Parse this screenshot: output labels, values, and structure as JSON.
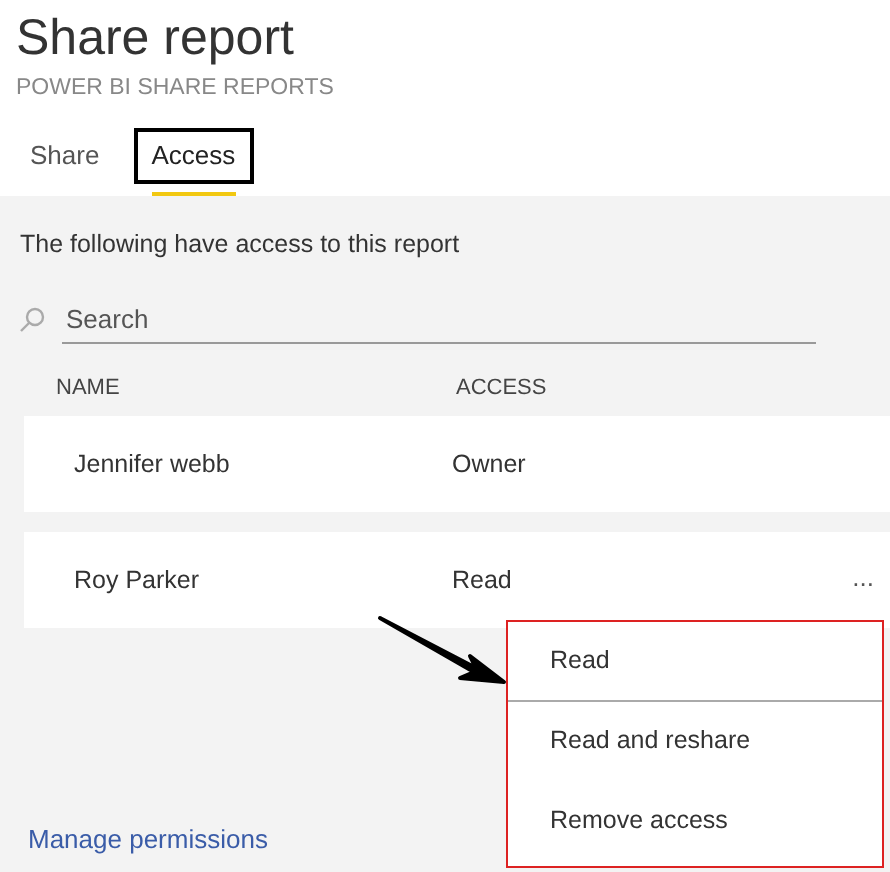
{
  "title": "Share report",
  "subtitle": "POWER BI SHARE REPORTS",
  "tabs": [
    {
      "label": "Share",
      "selected": false,
      "outlined": false
    },
    {
      "label": "Access",
      "selected": true,
      "outlined": true
    }
  ],
  "intro": "The following have access to this report",
  "search": {
    "placeholder": "Search"
  },
  "columns": [
    "NAME",
    "ACCESS"
  ],
  "rows": [
    {
      "name": "Jennifer webb",
      "access": "Owner"
    },
    {
      "name": "Roy Parker",
      "access": "Read",
      "more_label": "..."
    }
  ],
  "menu": {
    "items": [
      {
        "label": "Read",
        "selected": true
      },
      {
        "label": "Read and reshare",
        "selected": false
      },
      {
        "label": "Remove access",
        "selected": false
      }
    ]
  },
  "footer_link": "Manage permissions"
}
